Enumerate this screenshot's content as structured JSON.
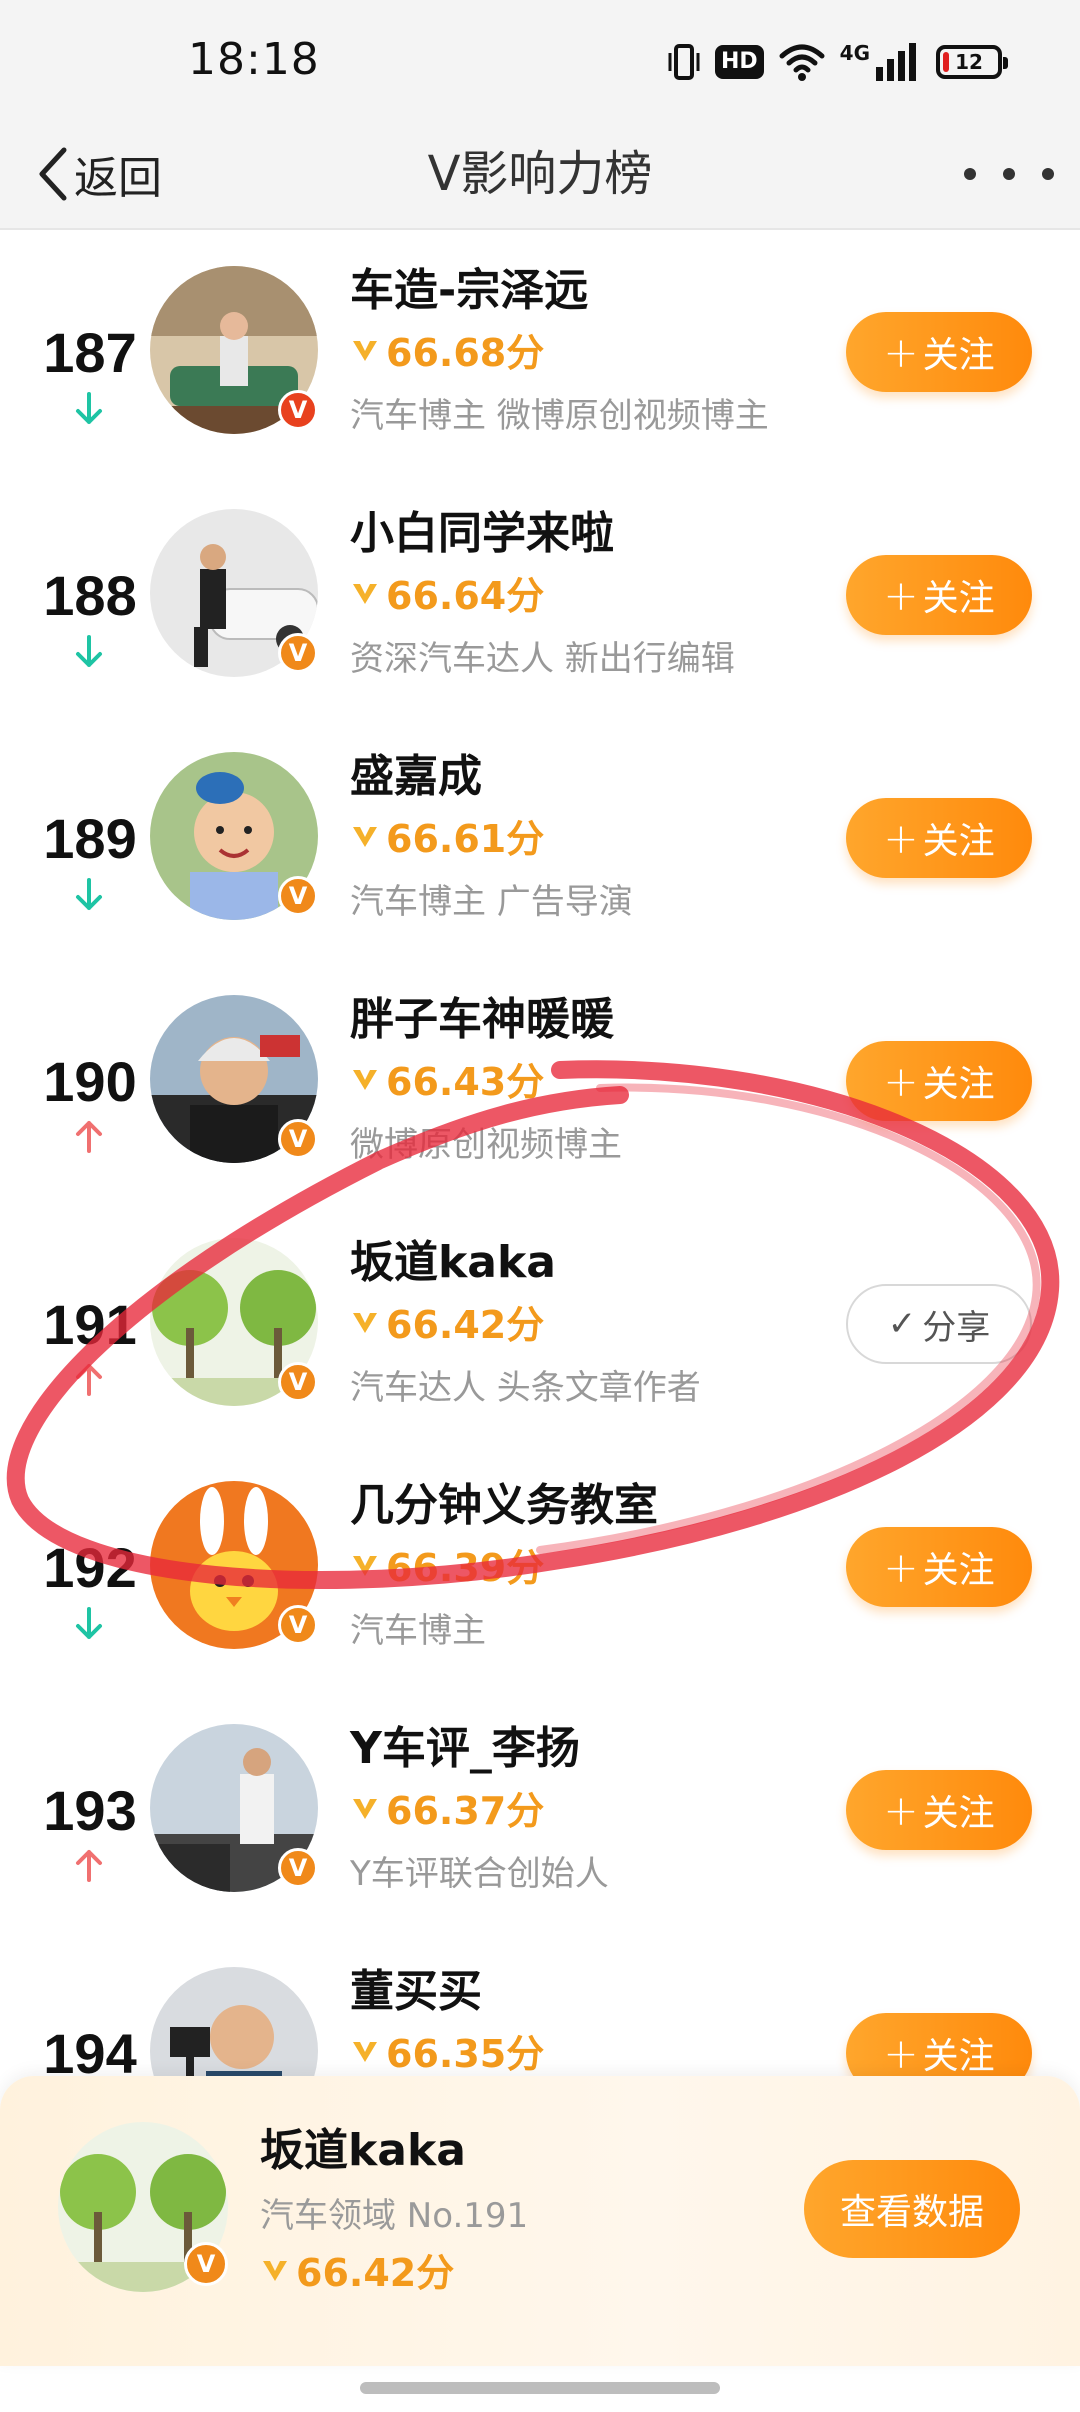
{
  "status_bar": {
    "time": "18:18",
    "hd": "HD",
    "network": "4G",
    "battery": "12",
    "battery_level": 0.12
  },
  "nav": {
    "back_label": "返回",
    "title": "V影响力榜"
  },
  "list": [
    {
      "rank": "187",
      "trend": "down",
      "name": "车造-宗泽远",
      "score": "66.68分",
      "desc": "汽车博主 微博原创视频博主",
      "badge": "red",
      "action": "follow",
      "button_label": "关注",
      "avatar": "red-sofa-photo"
    },
    {
      "rank": "188",
      "trend": "down",
      "name": "小白同学来啦",
      "score": "66.64分",
      "desc": "资深汽车达人 新出行编辑",
      "badge": "orange",
      "action": "follow",
      "button_label": "关注",
      "avatar": "man-leaning-on-car"
    },
    {
      "rank": "189",
      "trend": "down",
      "name": "盛嘉成",
      "score": "66.61分",
      "desc": "汽车博主 广告导演",
      "badge": "orange",
      "action": "follow",
      "button_label": "关注",
      "avatar": "smiling-man-blue-hat"
    },
    {
      "rank": "190",
      "trend": "up",
      "name": "胖子车神暖暖",
      "score": "66.43分",
      "desc": "微博原创视频博主",
      "badge": "orange",
      "action": "follow",
      "button_label": "关注",
      "avatar": "man-with-helmet"
    },
    {
      "rank": "191",
      "trend": "up",
      "name": "坂道kaka",
      "score": "66.42分",
      "desc": "汽车达人 头条文章作者",
      "badge": "orange",
      "action": "share",
      "button_label": "分享",
      "avatar": "green-trees"
    },
    {
      "rank": "192",
      "trend": "down",
      "name": "几分钟义务教室",
      "score": "66.39分",
      "desc": "汽车博主",
      "badge": "orange",
      "action": "follow",
      "button_label": "关注",
      "avatar": "cartoon-bunny-chick"
    },
    {
      "rank": "193",
      "trend": "up",
      "name": "Y车评_李扬",
      "score": "66.37分",
      "desc": "Y车评联合创始人",
      "badge": "orange",
      "action": "follow",
      "button_label": "关注",
      "avatar": "man-by-car-road"
    },
    {
      "rank": "194",
      "trend": "none",
      "name": "董买买",
      "score": "66.35分",
      "desc": "",
      "badge": "none",
      "action": "follow",
      "button_label": "关注",
      "avatar": "man-with-camera"
    }
  ],
  "me": {
    "name": "坂道kaka",
    "field": "汽车领域 No.191",
    "score": "66.42分",
    "button_label": "查看数据"
  },
  "colors": {
    "accent": "#ff8a0c",
    "score": "#f39a1c",
    "trend_down": "#1ec4a4",
    "trend_up": "#f07070",
    "annotation": "#e8283a"
  }
}
